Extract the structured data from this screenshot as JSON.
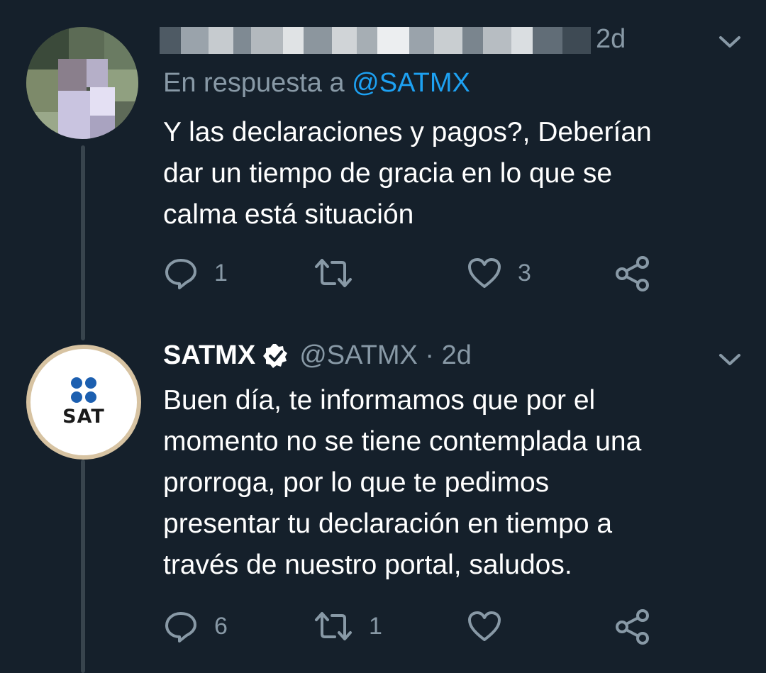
{
  "tweet1": {
    "author_name": "",
    "timestamp": "2d",
    "reply_prefix": "En respuesta a ",
    "reply_mention": "@SATMX",
    "text": "Y las declaraciones y pagos?, Deberían\ndar un tiempo de gracia en lo que se\ncalma está situación",
    "actions": {
      "replies": "1",
      "retweets": "",
      "likes": "3"
    }
  },
  "tweet2": {
    "author_name": "SATMX",
    "handle": "@SATMX",
    "separator": " · ",
    "timestamp": "2d",
    "avatar_text": "SAT",
    "text": "Buen día, te informamos que por el\nmomento no se tiene contemplada una\nprorroga, por lo que te pedimos\npresentar tu declaración en tiempo a\ntravés de nuestro portal, saludos.",
    "actions": {
      "replies": "6",
      "retweets": "1",
      "likes": ""
    }
  },
  "colors": {
    "background": "#15202b",
    "muted": "#8899a6",
    "link": "#1da1f2",
    "thread_line": "#38444d"
  },
  "icons": [
    "reply-icon",
    "retweet-icon",
    "like-icon",
    "share-icon",
    "chevron-down-icon",
    "verified-badge-icon"
  ]
}
